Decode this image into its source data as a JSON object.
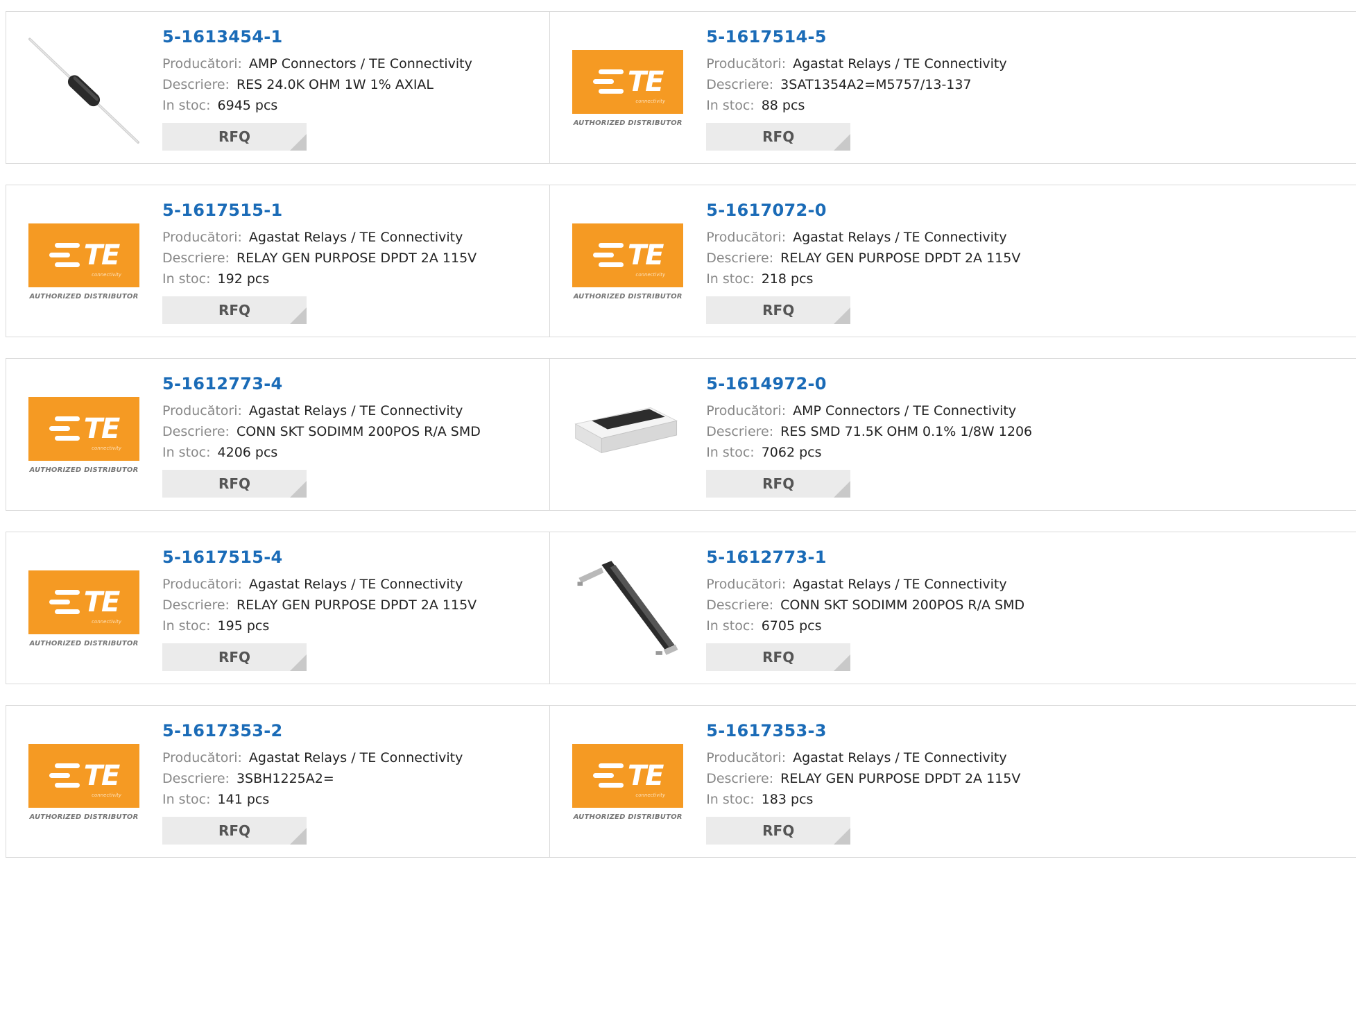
{
  "labels": {
    "manufacturer": "Producători:",
    "description": "Descriere:",
    "stock": "In stoc:",
    "rfq": "RFQ"
  },
  "logo": {
    "word": "TE",
    "sub": "connectivity",
    "distributor": "AUTHORIZED DISTRIBUTOR",
    "color": "#f59a23"
  },
  "colors": {
    "part_link": "#1a6bb7",
    "rfq_bg": "#ebebeb"
  },
  "products": [
    {
      "pn": "5-1613454-1",
      "manufacturer": "AMP Connectors / TE Connectivity",
      "description": "RES 24.0K OHM 1W 1% AXIAL",
      "stock": "6945 pcs",
      "image": "axial-resistor"
    },
    {
      "pn": "5-1617514-5",
      "manufacturer": "Agastat Relays / TE Connectivity",
      "description": "3SAT1354A2=M5757/13-137",
      "stock": "88 pcs",
      "image": "te-logo"
    },
    {
      "pn": "5-1617515-1",
      "manufacturer": "Agastat Relays / TE Connectivity",
      "description": "RELAY GEN PURPOSE DPDT 2A 115V",
      "stock": "192 pcs",
      "image": "te-logo"
    },
    {
      "pn": "5-1617072-0",
      "manufacturer": "Agastat Relays / TE Connectivity",
      "description": "RELAY GEN PURPOSE DPDT 2A 115V",
      "stock": "218 pcs",
      "image": "te-logo"
    },
    {
      "pn": "5-1612773-4",
      "manufacturer": "Agastat Relays / TE Connectivity",
      "description": "CONN SKT SODIMM 200POS R/A SMD",
      "stock": "4206 pcs",
      "image": "te-logo"
    },
    {
      "pn": "5-1614972-0",
      "manufacturer": "AMP Connectors / TE Connectivity",
      "description": "RES SMD 71.5K OHM 0.1% 1/8W 1206",
      "stock": "7062 pcs",
      "image": "smd-resistor"
    },
    {
      "pn": "5-1617515-4",
      "manufacturer": "Agastat Relays / TE Connectivity",
      "description": "RELAY GEN PURPOSE DPDT 2A 115V",
      "stock": "195 pcs",
      "image": "te-logo"
    },
    {
      "pn": "5-1612773-1",
      "manufacturer": "Agastat Relays / TE Connectivity",
      "description": "CONN SKT SODIMM 200POS R/A SMD",
      "stock": "6705 pcs",
      "image": "sodimm-socket"
    },
    {
      "pn": "5-1617353-2",
      "manufacturer": "Agastat Relays / TE Connectivity",
      "description": "3SBH1225A2=",
      "stock": "141 pcs",
      "image": "te-logo"
    },
    {
      "pn": "5-1617353-3",
      "manufacturer": "Agastat Relays / TE Connectivity",
      "description": "RELAY GEN PURPOSE DPDT 2A 115V",
      "stock": "183 pcs",
      "image": "te-logo"
    }
  ]
}
